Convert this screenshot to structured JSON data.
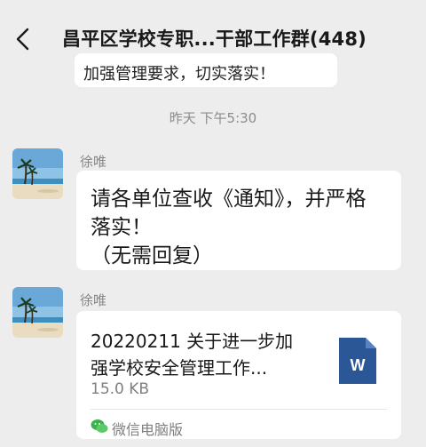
{
  "header": {
    "title": "昌平区学校专职...干部工作群(448)",
    "back_icon": "chevron-left-icon"
  },
  "previous_message": {
    "partial_text": "加强管理要求，切实落实！"
  },
  "timestamp": "昨天 下午5:30",
  "messages": [
    {
      "sender": "徐唯",
      "avatar_icon": "beach-palm-avatar",
      "lines": [
        "请各单位查收《通知》，并严格",
        "落实！",
        "（无需回复）"
      ]
    },
    {
      "sender": "徐唯",
      "avatar_icon": "beach-palm-avatar",
      "file": {
        "title_lines": [
          "20220211 关于进一步加",
          "强学校安全管理工作..."
        ],
        "size": "15.0 KB",
        "icon": "word-document-icon",
        "icon_letter": "W",
        "source_label": "微信电脑版",
        "source_icon": "wechat-icon"
      }
    }
  ],
  "colors": {
    "background": "#ededed",
    "bubble": "#ffffff",
    "word_blue": "#2b5797",
    "wechat_green": "#3cb34a"
  }
}
